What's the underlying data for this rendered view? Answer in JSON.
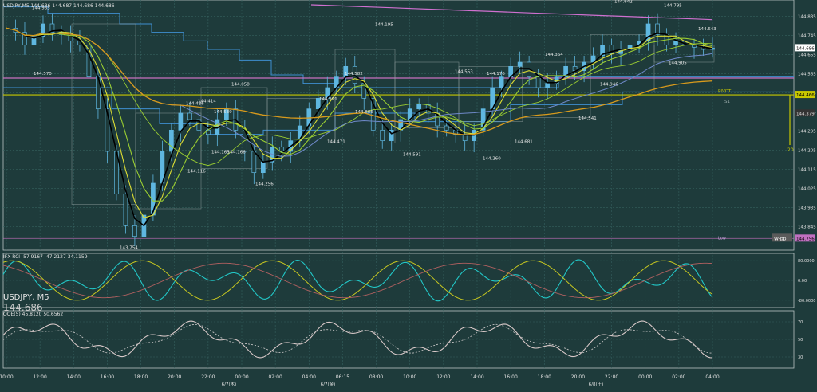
{
  "header": {
    "symbol_line": "USDJPY,M5  144.686 144.687 144.686 144.686",
    "symbol_big": "USDJPY, M5",
    "price_big": "144.686"
  },
  "colors": {
    "background": "#1e3b3b",
    "grid": "#35605e",
    "candle": "#5fb7e0",
    "pivot": "#c8c800",
    "ma_black": "#000000",
    "ma_green": "#9acd32",
    "ma_yellow": "#dddd33",
    "ma_orange": "#d89a1c",
    "ma_blue": "#6f89c9",
    "ma_pink": "#c96fbf",
    "band_blue": "#3f8fd0",
    "stoch_cyan": "#22c7c7",
    "stoch_yellow": "#c8c820",
    "stoch_red": "#b06060",
    "qqe_solid": "#d8c8c8",
    "qqe_dotted": "#c0c0c0"
  },
  "chart_data": [
    {
      "type": "candlestick",
      "title": "USDJPY,M5",
      "y_ticks": [
        "144.835",
        "144.745",
        "144.655",
        "144.565",
        "144.475",
        "144.385",
        "144.295",
        "144.205",
        "144.115",
        "144.025",
        "143.935",
        "143.845"
      ],
      "ylim": [
        143.75,
        144.89
      ],
      "x_ticks": [
        "10:00",
        "12:00",
        "14:00",
        "16:00",
        "18:00",
        "20:00",
        "22:00",
        "00:00",
        "02:00",
        "04:00",
        "06:15",
        "08:00",
        "10:00",
        "12:00",
        "14:00",
        "16:00",
        "18:00",
        "20:00",
        "22:00",
        "00:00",
        "02:00",
        "04:00"
      ],
      "date_labels": [
        "6/7(木)",
        "6/7(金)",
        "6/8(土)"
      ],
      "price_labels": [
        "144.965",
        "144.570",
        "143.754",
        "144.116",
        "144.165",
        "144.166",
        "144.436",
        "144.414",
        "144.539",
        "144.058",
        "144.256",
        "144.471",
        "144.591",
        "144.582",
        "144.806",
        "144.195",
        "144.591",
        "144.553",
        "144.176",
        "144.260",
        "144.681",
        "144.364",
        "144.541",
        "144.946",
        "144.642",
        "144.905",
        "144.795",
        "144.643"
      ],
      "right_tags": [
        "144.686",
        "144.466",
        "144.379",
        "144.756"
      ],
      "annotations": [
        "PIVOT",
        "S1",
        "Low",
        "W-pp",
        "20"
      ],
      "close": [
        144.78,
        144.76,
        144.7,
        144.74,
        144.8,
        144.76,
        144.75,
        144.72,
        144.7,
        144.55,
        144.4,
        144.2,
        144.0,
        143.85,
        143.8,
        143.9,
        144.05,
        144.2,
        144.3,
        144.38,
        144.35,
        144.3,
        144.28,
        144.35,
        144.4,
        144.3,
        144.2,
        144.1,
        144.15,
        144.22,
        144.2,
        144.25,
        144.32,
        144.4,
        144.45,
        144.5,
        144.55,
        144.6,
        144.52,
        144.45,
        144.3,
        144.25,
        144.3,
        144.35,
        144.4,
        144.42,
        144.38,
        144.32,
        144.3,
        144.28,
        144.25,
        144.3,
        144.4,
        144.5,
        144.55,
        144.6,
        144.62,
        144.55,
        144.5,
        144.52,
        144.55,
        144.6,
        144.58,
        144.62,
        144.65,
        144.7,
        144.66,
        144.68,
        144.7,
        144.72,
        144.8,
        144.75,
        144.7,
        144.72,
        144.7,
        144.69,
        144.68,
        144.686
      ]
    },
    {
      "type": "line",
      "title": "IFX-RCI -57.9167 -47.2127 34.1159",
      "y_ticks": [
        "80.0000",
        "0.00",
        "-80.0000"
      ],
      "ylim": [
        -100,
        100
      ]
    },
    {
      "type": "line",
      "title": "QQE(5) 45.8120 50.6562",
      "y_ticks": [
        "70",
        "50",
        "30"
      ],
      "ylim": [
        20,
        80
      ]
    }
  ]
}
